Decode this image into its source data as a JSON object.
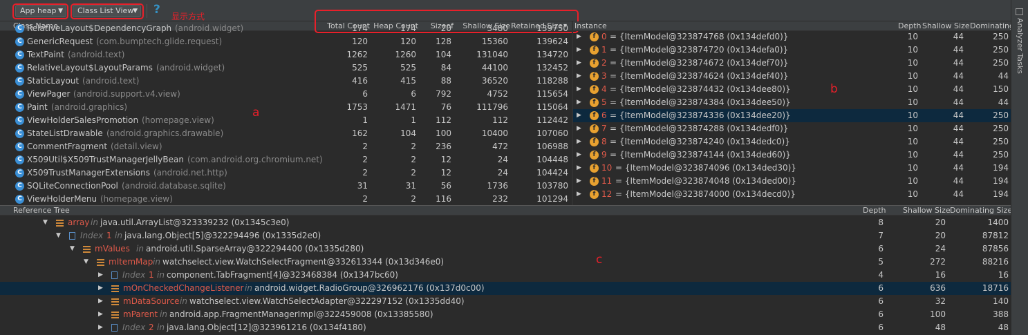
{
  "toolbar": {
    "heap_select": "App heap",
    "view_select": "Class List View",
    "help": "?",
    "annotation_label": "显示方式"
  },
  "annotations": {
    "a": "a",
    "b": "b",
    "c": "c"
  },
  "right_panel": {
    "label": "Analyzer Tasks"
  },
  "class_table": {
    "headers": [
      "Class Name",
      "Total Count",
      "Heap Count",
      "Sizeof",
      "Shallow Size",
      "Retained Size"
    ],
    "sort_indicator": "▾",
    "rows": [
      {
        "name": "RelativeLayout$DependencyGraph",
        "pkg": "(android.widget)",
        "total": "174",
        "heap": "174",
        "sizeof": "20",
        "shallow": "3480",
        "retained": "139750"
      },
      {
        "name": "GenericRequest",
        "pkg": "(com.bumptech.glide.request)",
        "total": "120",
        "heap": "120",
        "sizeof": "128",
        "shallow": "15360",
        "retained": "139624"
      },
      {
        "name": "TextPaint",
        "pkg": "(android.text)",
        "total": "1262",
        "heap": "1260",
        "sizeof": "104",
        "shallow": "131040",
        "retained": "134720"
      },
      {
        "name": "RelativeLayout$LayoutParams",
        "pkg": "(android.widget)",
        "total": "525",
        "heap": "525",
        "sizeof": "84",
        "shallow": "44100",
        "retained": "132452"
      },
      {
        "name": "StaticLayout",
        "pkg": "(android.text)",
        "total": "416",
        "heap": "415",
        "sizeof": "88",
        "shallow": "36520",
        "retained": "118288"
      },
      {
        "name": "ViewPager",
        "pkg": "(android.support.v4.view)",
        "total": "6",
        "heap": "6",
        "sizeof": "792",
        "shallow": "4752",
        "retained": "115654"
      },
      {
        "name": "Paint",
        "pkg": "(android.graphics)",
        "total": "1753",
        "heap": "1471",
        "sizeof": "76",
        "shallow": "111796",
        "retained": "115064"
      },
      {
        "name": "ViewHolderSalesPromotion",
        "pkg": "(homepage.view)",
        "total": "1",
        "heap": "1",
        "sizeof": "112",
        "shallow": "112",
        "retained": "112442"
      },
      {
        "name": "StateListDrawable",
        "pkg": "(android.graphics.drawable)",
        "total": "162",
        "heap": "104",
        "sizeof": "100",
        "shallow": "10400",
        "retained": "107060"
      },
      {
        "name": "CommentFragment",
        "pkg": "(detail.view)",
        "total": "2",
        "heap": "2",
        "sizeof": "236",
        "shallow": "472",
        "retained": "106988"
      },
      {
        "name": "X509Util$X509TrustManagerJellyBean",
        "pkg": "(com.android.org.chromium.net)",
        "total": "2",
        "heap": "2",
        "sizeof": "12",
        "shallow": "24",
        "retained": "104448"
      },
      {
        "name": "X509TrustManagerExtensions",
        "pkg": "(android.net.http)",
        "total": "2",
        "heap": "2",
        "sizeof": "12",
        "shallow": "24",
        "retained": "104424"
      },
      {
        "name": "SQLiteConnectionPool",
        "pkg": "(android.database.sqlite)",
        "total": "31",
        "heap": "31",
        "sizeof": "56",
        "shallow": "1736",
        "retained": "103780"
      },
      {
        "name": "ViewHolderMenu",
        "pkg": "(homepage.view)",
        "total": "2",
        "heap": "2",
        "sizeof": "116",
        "shallow": "232",
        "retained": "101294"
      }
    ]
  },
  "instance_table": {
    "headers": [
      "Instance",
      "Depth",
      "Shallow Size",
      "Dominating..."
    ],
    "rows": [
      {
        "index": "0",
        "value": "= {ItemModel@323874768 (0x134defd0)}",
        "depth": "10",
        "shallow": "44",
        "dom": "250"
      },
      {
        "index": "1",
        "value": "= {ItemModel@323874720 (0x134defa0)}",
        "depth": "10",
        "shallow": "44",
        "dom": "250"
      },
      {
        "index": "2",
        "value": "= {ItemModel@323874672 (0x134def70)}",
        "depth": "10",
        "shallow": "44",
        "dom": "250"
      },
      {
        "index": "3",
        "value": "= {ItemModel@323874624 (0x134def40)}",
        "depth": "10",
        "shallow": "44",
        "dom": "44"
      },
      {
        "index": "4",
        "value": "= {ItemModel@323874432 (0x134dee80)}",
        "depth": "10",
        "shallow": "44",
        "dom": "150"
      },
      {
        "index": "5",
        "value": "= {ItemModel@323874384 (0x134dee50)}",
        "depth": "10",
        "shallow": "44",
        "dom": "44"
      },
      {
        "index": "6",
        "value": "= {ItemModel@323874336 (0x134dee20)}",
        "depth": "10",
        "shallow": "44",
        "dom": "250"
      },
      {
        "index": "7",
        "value": "= {ItemModel@323874288 (0x134dedf0)}",
        "depth": "10",
        "shallow": "44",
        "dom": "250"
      },
      {
        "index": "8",
        "value": "= {ItemModel@323874240 (0x134dedc0)}",
        "depth": "10",
        "shallow": "44",
        "dom": "250"
      },
      {
        "index": "9",
        "value": "= {ItemModel@323874144 (0x134ded60)}",
        "depth": "10",
        "shallow": "44",
        "dom": "250"
      },
      {
        "index": "10",
        "value": "= {ItemModel@323874096 (0x134ded30)}",
        "depth": "10",
        "shallow": "44",
        "dom": "194"
      },
      {
        "index": "11",
        "value": "= {ItemModel@323874048 (0x134ded00)}",
        "depth": "10",
        "shallow": "44",
        "dom": "194"
      },
      {
        "index": "12",
        "value": "= {ItemModel@323874000 (0x134decd0)}",
        "depth": "10",
        "shallow": "44",
        "dom": "194"
      }
    ]
  },
  "reference_tree": {
    "headers": [
      "Reference Tree",
      "Depth",
      "Shallow Size",
      "Dominating Size"
    ],
    "in_word": "in",
    "rows": [
      {
        "field": "array",
        "index_prefix": "",
        "owner": "java.util.ArrayList@323339232 (0x1345c3e0)",
        "depth": "8",
        "shallow": "20",
        "dom": "1400"
      },
      {
        "field": "1",
        "index_prefix": "Index",
        "owner": "java.lang.Object[5]@322294496 (0x1335d2e0)",
        "depth": "7",
        "shallow": "20",
        "dom": "87812"
      },
      {
        "field": "mValues",
        "index_prefix": "",
        "owner": "android.util.SparseArray@322294400 (0x1335d280)",
        "depth": "6",
        "shallow": "24",
        "dom": "87856"
      },
      {
        "field": "mItemMap",
        "index_prefix": "",
        "owner": "watchselect.view.WatchSelectFragment@332613344 (0x13d346e0)",
        "depth": "5",
        "shallow": "272",
        "dom": "88216"
      },
      {
        "field": "1",
        "index_prefix": "Index",
        "owner": "component.TabFragment[4]@323468384 (0x1347bc60)",
        "depth": "4",
        "shallow": "16",
        "dom": "16"
      },
      {
        "field": "mOnCheckedChangeListener",
        "index_prefix": "",
        "owner": "android.widget.RadioGroup@326962176 (0x137d0c00)",
        "depth": "6",
        "shallow": "636",
        "dom": "18716"
      },
      {
        "field": "mDataSource",
        "index_prefix": "",
        "owner": "watchselect.view.WatchSelectAdapter@322297152 (0x1335dd40)",
        "depth": "6",
        "shallow": "32",
        "dom": "140"
      },
      {
        "field": "mParent",
        "index_prefix": "",
        "owner": "android.app.FragmentManagerImpl@322459008 (0x13385580)",
        "depth": "6",
        "shallow": "100",
        "dom": "388"
      },
      {
        "field": "2",
        "index_prefix": "Index",
        "owner": "java.lang.Object[12]@323961216 (0x134f4180)",
        "depth": "6",
        "shallow": "48",
        "dom": "48"
      }
    ]
  },
  "colors": {
    "accent_red": "#e8202a",
    "selection": "#0d293e",
    "class_icon": "#3a8fd6",
    "field_icon": "#e8a130"
  }
}
